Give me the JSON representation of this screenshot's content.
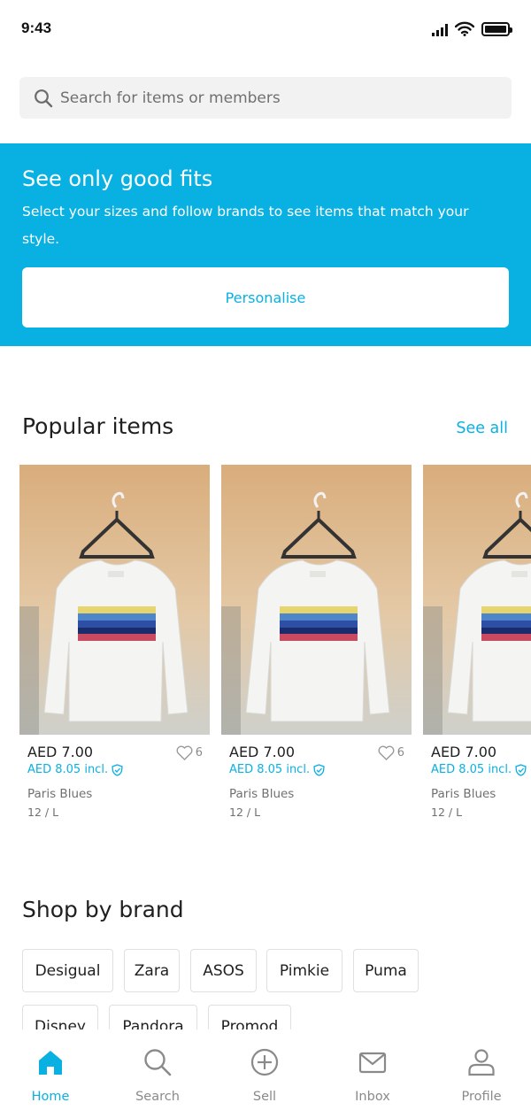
{
  "status_bar": {
    "time": "9:43"
  },
  "search": {
    "placeholder": "Search for items or members"
  },
  "promo": {
    "title": "See only good fits",
    "text": "Select your sizes and follow brands to see items that match your style.",
    "button_label": "Personalise"
  },
  "popular": {
    "title": "Popular items",
    "see_all": "See all",
    "items": [
      {
        "price": "AED 7.00",
        "incl_price": "AED 8.05 incl.",
        "favorites": "6",
        "brand": "Paris Blues",
        "size": "12 / L"
      },
      {
        "price": "AED 7.00",
        "incl_price": "AED 8.05 incl.",
        "favorites": "6",
        "brand": "Paris Blues",
        "size": "12 / L"
      },
      {
        "price": "AED 7.00",
        "incl_price": "AED 8.05 incl.",
        "brand": "Paris Blues",
        "size": "12 / L"
      }
    ]
  },
  "brands": {
    "title": "Shop by brand",
    "chips": [
      "Desigual",
      "Zara",
      "ASOS",
      "Pimkie",
      "Puma",
      "Disney",
      "Pandora",
      "Promod"
    ]
  },
  "tab_bar": {
    "tabs": [
      {
        "label": "Home",
        "icon": "home-icon",
        "active": true
      },
      {
        "label": "Search",
        "icon": "search-icon",
        "active": false
      },
      {
        "label": "Sell",
        "icon": "plus-circle-icon",
        "active": false
      },
      {
        "label": "Inbox",
        "icon": "envelope-icon",
        "active": false
      },
      {
        "label": "Profile",
        "icon": "person-icon",
        "active": false
      }
    ]
  },
  "colors": {
    "accent": "#09b1e2",
    "text": "#1f1f1f",
    "muted": "#707070"
  }
}
